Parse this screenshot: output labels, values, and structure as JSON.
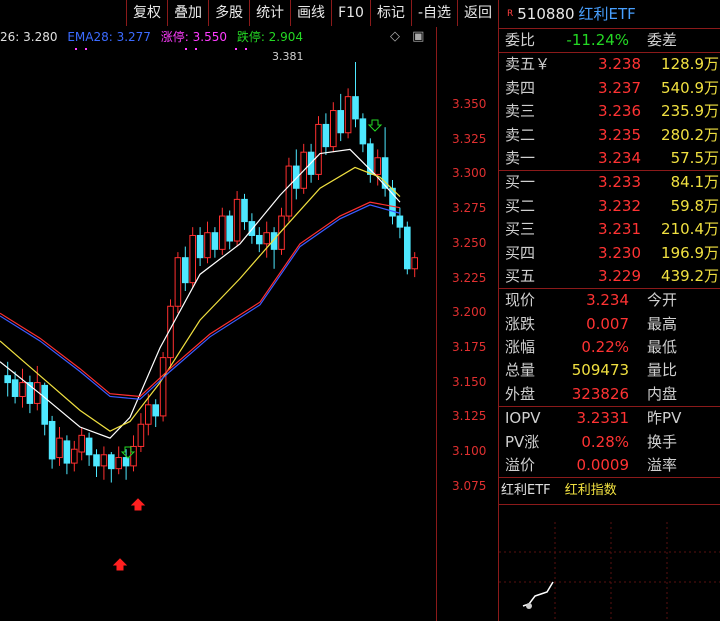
{
  "toolbar": {
    "buttons": [
      "复权",
      "叠加",
      "多股",
      "统计",
      "画线",
      "F10",
      "标记",
      "-自选",
      "返回"
    ]
  },
  "indicators": {
    "ema20": "26: 3.280",
    "ema28": "EMA28: 3.277",
    "limit_up": "涨停: 3.550",
    "limit_down": "跌停: 2.904"
  },
  "chart": {
    "high_label": "3.381",
    "y_ticks": [
      "3.350",
      "3.325",
      "3.300",
      "3.275",
      "3.250",
      "3.225",
      "3.200",
      "3.175",
      "3.150",
      "3.125",
      "3.100",
      "3.075"
    ],
    "colors": {
      "up": "#ff3030",
      "down": "#4ee8ff",
      "ema_fast": "#ffffff",
      "ema_mid": "#f0e040",
      "ema_slow_a": "#ff3030",
      "ema_slow_b": "#3b5bff"
    }
  },
  "quote": {
    "r_badge": "R",
    "code": "510880",
    "name": "红利ETF",
    "weibi_label": "委比",
    "weibi_value": "-11.24%",
    "weicha_label": "委差",
    "sells": [
      {
        "label": "卖五￥",
        "price": "3.238",
        "vol": "128.9万"
      },
      {
        "label": "卖四",
        "price": "3.237",
        "vol": "540.9万"
      },
      {
        "label": "卖三",
        "price": "3.236",
        "vol": "235.9万"
      },
      {
        "label": "卖二",
        "price": "3.235",
        "vol": "280.2万"
      },
      {
        "label": "卖一",
        "price": "3.234",
        "vol": "57.5万"
      }
    ],
    "buys": [
      {
        "label": "买一",
        "price": "3.233",
        "vol": "84.1万"
      },
      {
        "label": "买二",
        "price": "3.232",
        "vol": "59.8万"
      },
      {
        "label": "买三",
        "price": "3.231",
        "vol": "210.4万"
      },
      {
        "label": "买四",
        "price": "3.230",
        "vol": "196.9万"
      },
      {
        "label": "买五",
        "price": "3.229",
        "vol": "439.2万"
      }
    ],
    "stats": [
      {
        "label": "现价",
        "value": "3.234",
        "label2": "今开"
      },
      {
        "label": "涨跌",
        "value": "0.007",
        "label2": "最高"
      },
      {
        "label": "涨幅",
        "value": "0.22%",
        "label2": "最低"
      },
      {
        "label": "总量",
        "value": "509473",
        "label2": "量比"
      },
      {
        "label": "外盘",
        "value": "323826",
        "label2": "内盘"
      }
    ],
    "iopv": [
      {
        "label": "IOPV",
        "value": "3.2331",
        "label2": "昨PV"
      },
      {
        "label": "PV涨",
        "value": "0.28%",
        "label2": "换手"
      },
      {
        "label": "溢价",
        "value": "0.0009",
        "label2": "溢率"
      }
    ],
    "tabs": [
      "红利ETF",
      "红利指数"
    ]
  }
}
